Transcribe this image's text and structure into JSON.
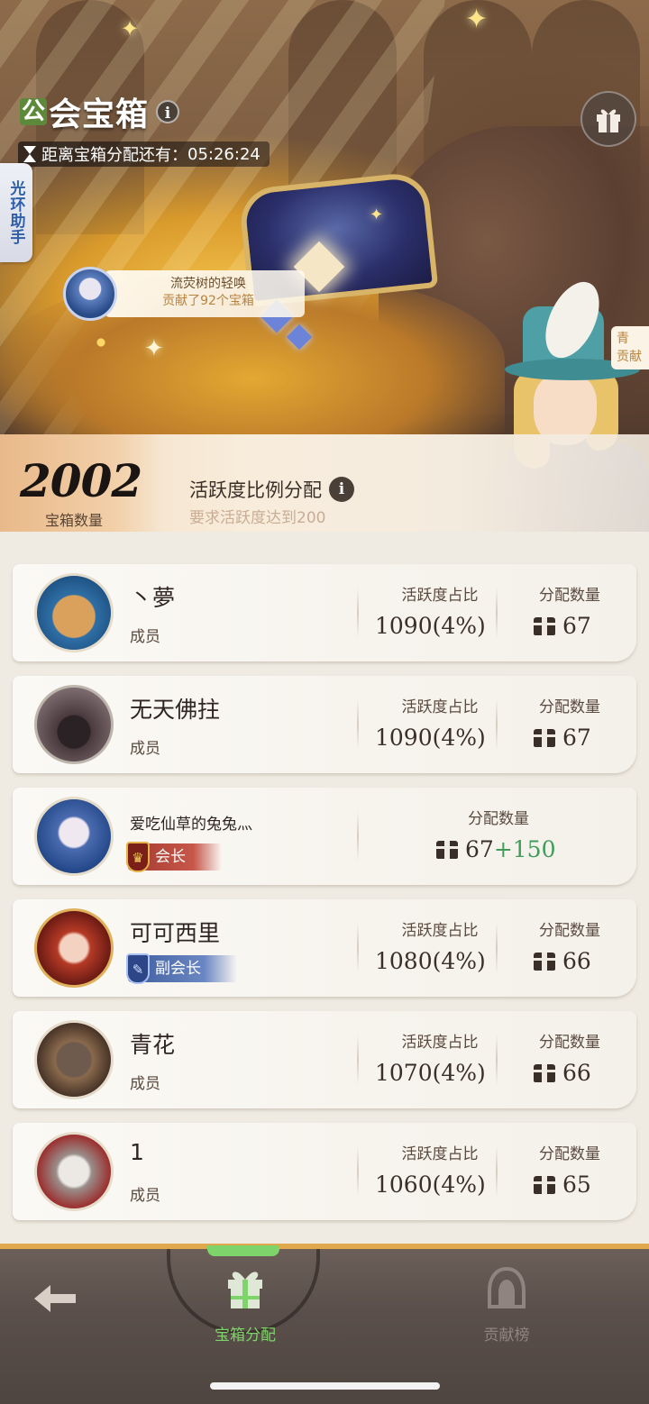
{
  "header": {
    "title_first_char": "公",
    "title_rest": "会宝箱",
    "countdown_label": "距离宝箱分配还有：",
    "countdown_time": "05:26:24",
    "side_tab_label": "光环助手",
    "contrib_name": "流荧树的轻唤",
    "contrib_text": "贡献了92个宝箱",
    "right_peek_top": "青",
    "right_peek_bottom": "贡献"
  },
  "stats": {
    "chest_count": "2002",
    "chest_count_label": "宝箱数量",
    "mode_title": "活跃度比例分配",
    "mode_requirement": "要求活跃度达到200"
  },
  "columns": {
    "activity_header": "活跃度占比",
    "allocation_header": "分配数量"
  },
  "members": [
    {
      "name": "丶夢",
      "role": "成员",
      "activity": "1090(4%)",
      "allocation": "67"
    },
    {
      "name": "无天佛拄",
      "role": "成员",
      "activity": "1090(4%)",
      "allocation": "67"
    },
    {
      "name": "爱吃仙草的兔兔灬",
      "role": "会长",
      "allocation": "67",
      "bonus": "+150"
    },
    {
      "name": "可可西里",
      "role": "副会长",
      "activity": "1080(4%)",
      "allocation": "66"
    },
    {
      "name": "青花",
      "role": "成员",
      "activity": "1070(4%)",
      "allocation": "66"
    },
    {
      "name": "1",
      "role": "成员",
      "activity": "1060(4%)",
      "allocation": "65"
    }
  ],
  "nav": {
    "chest_alloc_label": "宝箱分配",
    "contribution_label": "贡献榜"
  },
  "colors": {
    "accent_green": "#7fd36b",
    "bonus_green": "#3f9d59",
    "leader_red": "#a53a2e",
    "vice_blue": "#3f5d9e",
    "nav_border": "#e2a84c"
  }
}
